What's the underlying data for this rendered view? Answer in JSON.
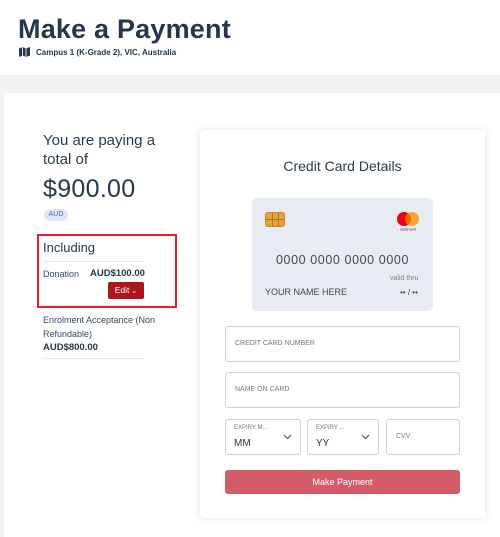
{
  "header": {
    "title": "Make a Payment",
    "location": "Campus 1 (K-Grade 2), VIC, Australia",
    "location_icon": "map-icon"
  },
  "summary": {
    "paying_text": "You are paying a total of",
    "total": "$900.00",
    "currency": "AUD",
    "including_title": "Including",
    "items": [
      {
        "label": "Donation",
        "value": "AUD$100.00",
        "edit_label": "Edit"
      },
      {
        "label": "Enrolment Acceptance (Non Refundable)",
        "value": "AUD$800.00"
      }
    ],
    "highlight_color": "#e0232b"
  },
  "card_form": {
    "title": "Credit Card Details",
    "preview": {
      "number": "0000 0000 0000 0000",
      "valid_thru_label": "valid thru",
      "name": "YOUR NAME HERE",
      "expiry": "•• / ••",
      "brand": "mastercard"
    },
    "fields": {
      "card_number_placeholder": "CREDIT CARD NUMBER",
      "name_placeholder": "NAME ON CARD",
      "expiry_month_label": "EXPIRY M...",
      "expiry_month_value": "MM",
      "expiry_year_label": "EXPIRY ...",
      "expiry_year_value": "YY",
      "cvv_placeholder": "CVV"
    },
    "submit_label": "Make Payment",
    "submit_color": "#d45c69"
  }
}
